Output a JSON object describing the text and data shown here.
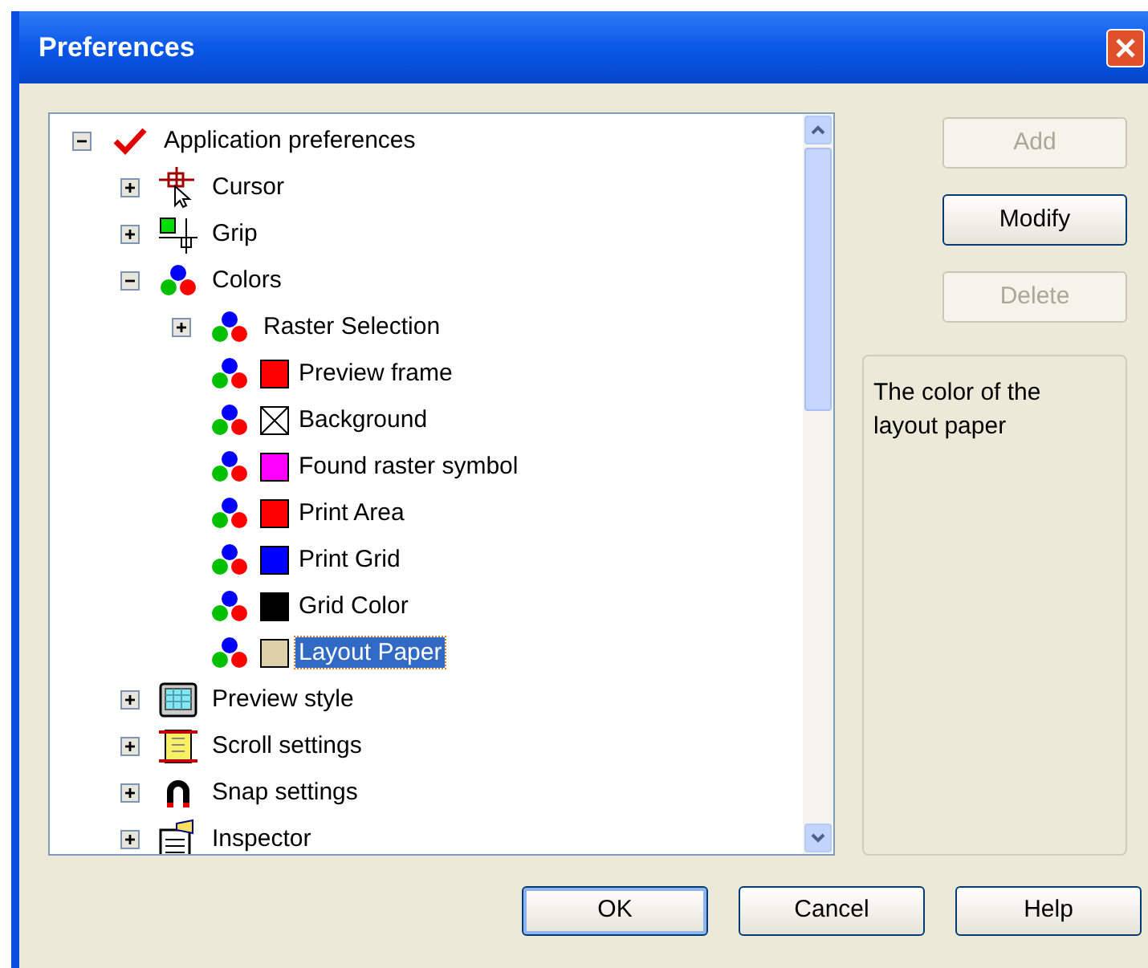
{
  "window": {
    "title": "Preferences"
  },
  "tree": [
    {
      "label": "Application preferences",
      "kind": "group",
      "expanded": true,
      "selected": false,
      "children": [
        {
          "label": "Cursor",
          "kind": "group",
          "expanded": false,
          "selected": false
        },
        {
          "label": "Grip",
          "kind": "group",
          "expanded": false,
          "selected": false
        },
        {
          "label": "Colors",
          "kind": "group",
          "expanded": true,
          "selected": false,
          "children": [
            {
              "label": "Raster Selection",
              "kind": "group",
              "expanded": false,
              "selected": false
            },
            {
              "label": "Preview frame",
              "kind": "swatch",
              "color": "#ff0000",
              "selected": false
            },
            {
              "label": "Background",
              "kind": "empty-swatch",
              "selected": false
            },
            {
              "label": "Found raster symbol",
              "kind": "swatch",
              "color": "#ff00ff",
              "selected": false
            },
            {
              "label": "Print Area",
              "kind": "swatch",
              "color": "#ff0000",
              "selected": false
            },
            {
              "label": "Print Grid",
              "kind": "swatch",
              "color": "#0000ff",
              "selected": false
            },
            {
              "label": "Grid Color",
              "kind": "swatch",
              "color": "#000000",
              "selected": false
            },
            {
              "label": "Layout Paper",
              "kind": "swatch",
              "color": "#ddd0a8",
              "selected": true
            }
          ]
        },
        {
          "label": "Preview style",
          "kind": "group",
          "expanded": false,
          "selected": false
        },
        {
          "label": "Scroll settings",
          "kind": "group",
          "expanded": false,
          "selected": false
        },
        {
          "label": "Snap settings",
          "kind": "group",
          "expanded": false,
          "selected": false
        },
        {
          "label": "Inspector",
          "kind": "group",
          "expanded": false,
          "selected": false
        }
      ]
    }
  ],
  "side_buttons": [
    {
      "label": "Add",
      "disabled": true
    },
    {
      "label": "Modify",
      "disabled": false
    },
    {
      "label": "Delete",
      "disabled": true
    }
  ],
  "description": "The color of the layout paper",
  "buttons": [
    {
      "label": "OK",
      "default": true
    },
    {
      "label": "Cancel",
      "default": false
    },
    {
      "label": "Help",
      "default": false
    }
  ]
}
